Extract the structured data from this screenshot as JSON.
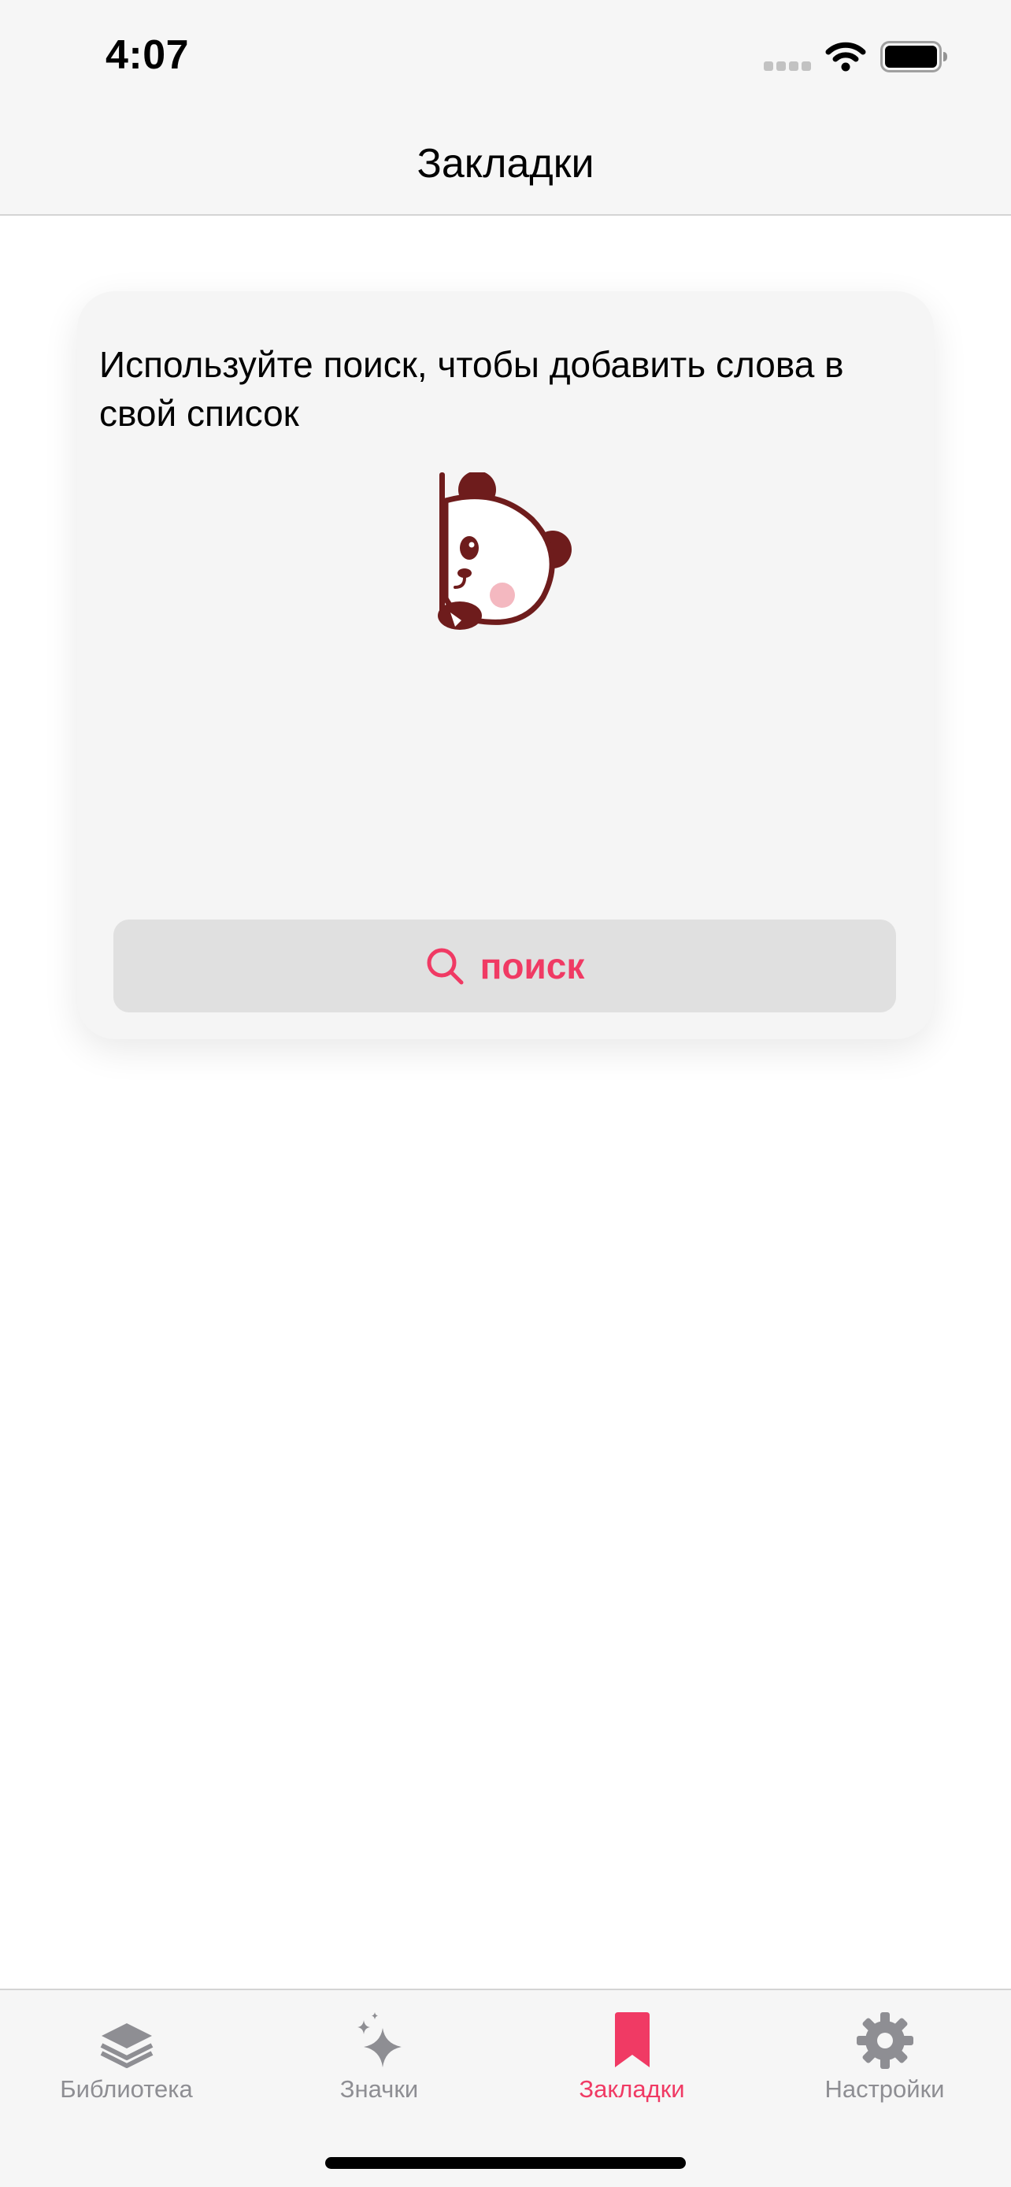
{
  "status_bar": {
    "time": "4:07"
  },
  "nav": {
    "title": "Закладки"
  },
  "card": {
    "message": "Используйте поиск, чтобы добавить слова в свой список",
    "search_button_label": "поиск"
  },
  "tabs": [
    {
      "label": "Библиотека",
      "icon": "stack-icon",
      "active": false
    },
    {
      "label": "Значки",
      "icon": "sparkles-icon",
      "active": false
    },
    {
      "label": "Закладки",
      "icon": "bookmark-icon",
      "active": true
    },
    {
      "label": "Настройки",
      "icon": "gear-icon",
      "active": false
    }
  ],
  "colors": {
    "accent": "#f03a64",
    "inactive": "#8e8e93",
    "panda": "#6e1c1c"
  }
}
